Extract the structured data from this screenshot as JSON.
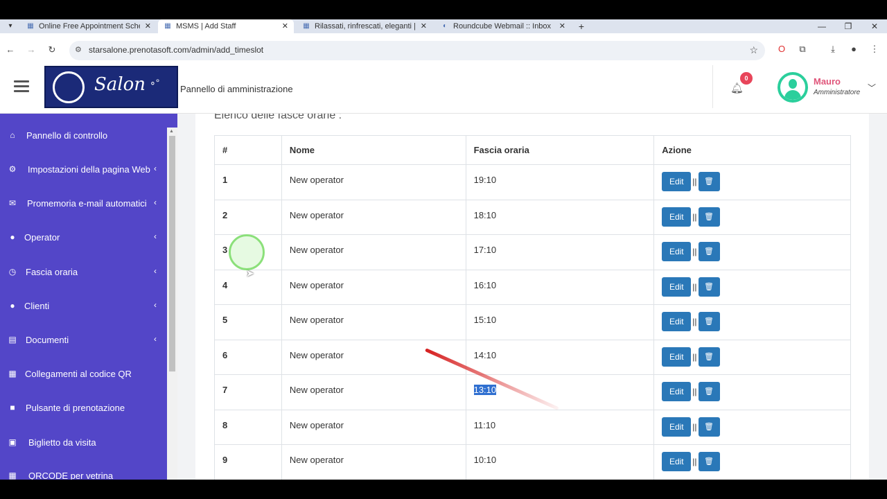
{
  "browser": {
    "tabs": [
      {
        "label": "Online Free Appointment Sche",
        "active": false,
        "favicon": "sheet-icon"
      },
      {
        "label": "MSMS | Add Staff",
        "active": true,
        "favicon": "sheet-icon"
      },
      {
        "label": "Rilassati, rinfrescati, eleganti || H",
        "active": false,
        "favicon": "sheet-icon"
      },
      {
        "label": "Roundcube Webmail :: Inbox",
        "active": false,
        "favicon": "roundcube-icon"
      }
    ],
    "url": "starsalone.prenotasoft.com/admin/add_timeslot"
  },
  "header": {
    "logo_text": "Salon",
    "title": "Pannello di amministrazione",
    "notifications_count": "0",
    "user_name": "Mauro",
    "user_role": "Amministratore"
  },
  "sidebar": {
    "items": [
      {
        "label": "Pannello di controllo",
        "icon": "home-icon",
        "chevron": false
      },
      {
        "label": "Impostazioni della pagina Web",
        "icon": "cogs-icon",
        "chevron": true
      },
      {
        "label": "Promemoria e-mail automatici",
        "icon": "envelope-icon",
        "chevron": true
      },
      {
        "label": "Operator",
        "icon": "user-icon",
        "chevron": true
      },
      {
        "label": "Fascia oraria",
        "icon": "clock-icon",
        "chevron": true
      },
      {
        "label": "Clienti",
        "icon": "user-icon",
        "chevron": true
      },
      {
        "label": "Documenti",
        "icon": "file-icon",
        "chevron": true
      },
      {
        "label": "Collegamenti al codice QR",
        "icon": "qrcode-icon",
        "chevron": false
      },
      {
        "label": "Pulsante di prenotazione",
        "icon": "square-icon",
        "chevron": false
      },
      {
        "label": "Biglietto da visita",
        "icon": "id-card-icon",
        "chevron": false
      },
      {
        "label": "QRCODE per vetrina",
        "icon": "qrcode-icon",
        "chevron": false
      }
    ]
  },
  "main": {
    "section_title": "Elenco delle fasce orarie :",
    "table": {
      "headers": [
        "#",
        "Nome",
        "Fascia oraria",
        "Azione"
      ],
      "edit_label": "Edit",
      "separator": "||",
      "rows": [
        {
          "num": "1",
          "name": "New operator",
          "slot": "19:10"
        },
        {
          "num": "2",
          "name": "New operator",
          "slot": "18:10"
        },
        {
          "num": "3",
          "name": "New operator",
          "slot": "17:10"
        },
        {
          "num": "4",
          "name": "New operator",
          "slot": "16:10"
        },
        {
          "num": "5",
          "name": "New operator",
          "slot": "15:10"
        },
        {
          "num": "6",
          "name": "New operator",
          "slot": "14:10"
        },
        {
          "num": "7",
          "name": "New operator",
          "slot": "13:10"
        },
        {
          "num": "8",
          "name": "New operator",
          "slot": "11:10"
        },
        {
          "num": "9",
          "name": "New operator",
          "slot": "10:10"
        }
      ],
      "selected_row": 6
    }
  },
  "colors": {
    "sidebar_bg": "#5346c8",
    "button_blue": "#2a78b8",
    "badge_red": "#e8455a",
    "avatar_green": "#2bcf9c",
    "username_pink": "#e0557a"
  }
}
